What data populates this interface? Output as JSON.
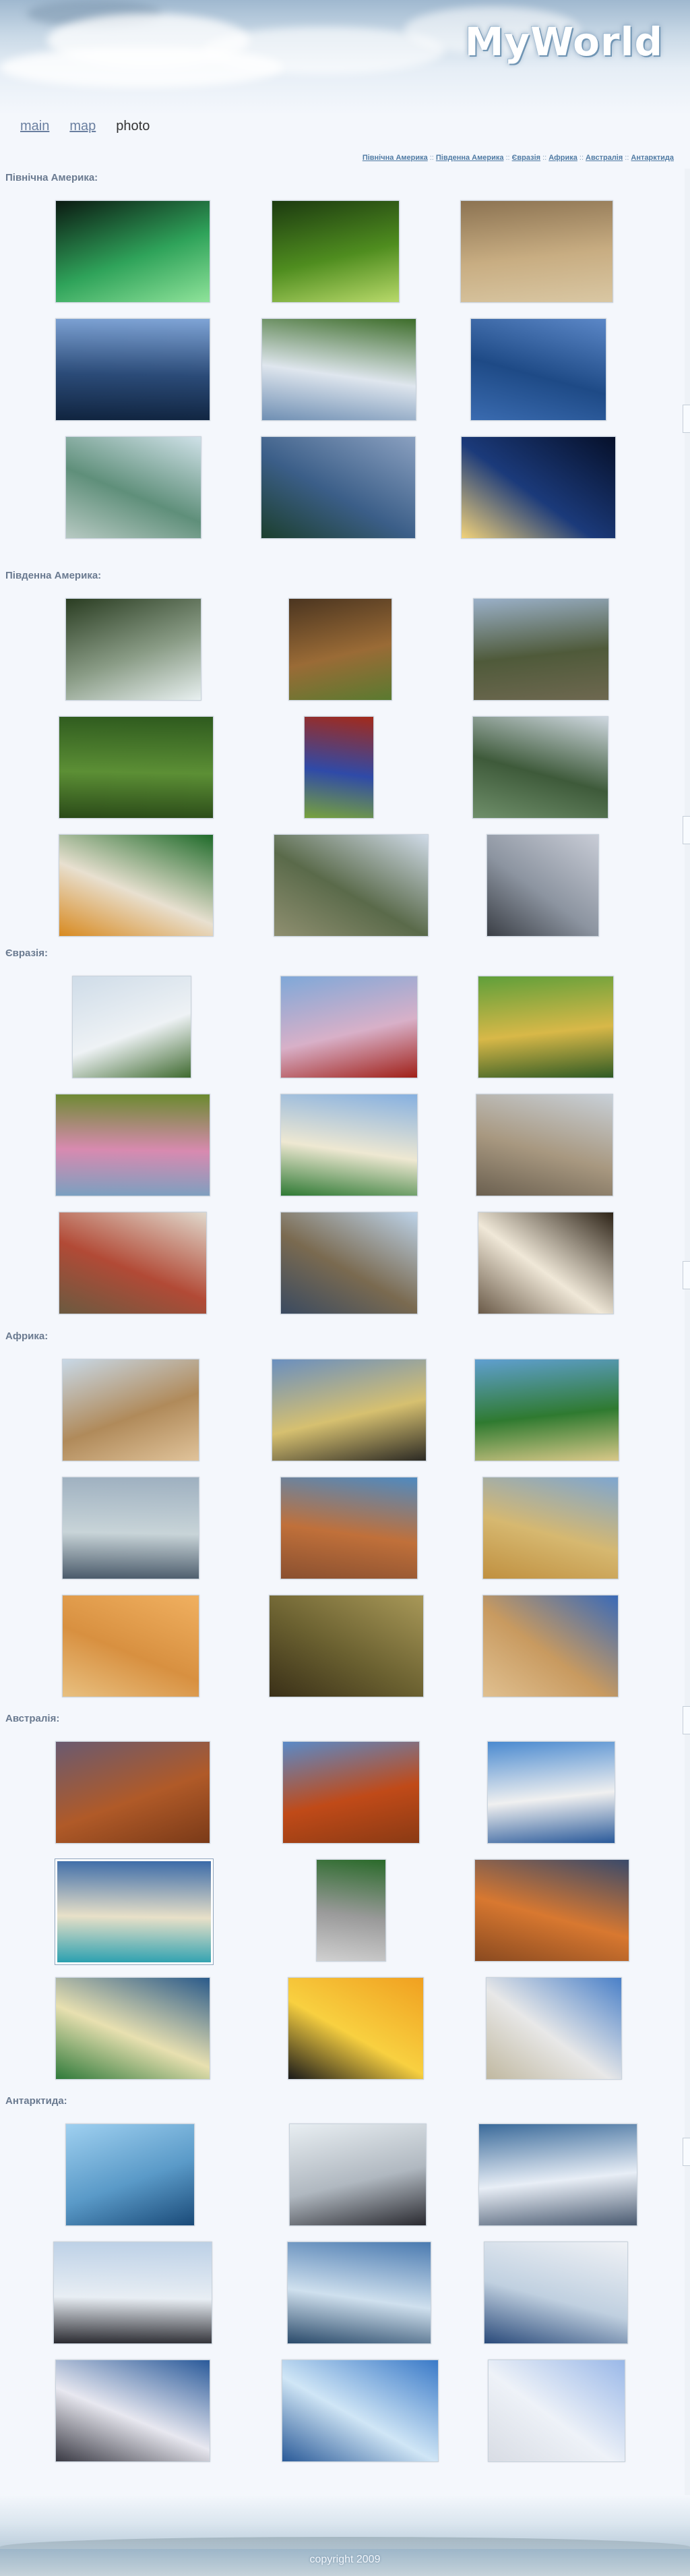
{
  "brand": "MyWorld",
  "nav": [
    {
      "label": "main",
      "link": true
    },
    {
      "label": "map",
      "link": true
    },
    {
      "label": "photo",
      "link": false
    }
  ],
  "breadcrumbs": [
    "Північна Америка",
    "Південна Америка",
    "Євразія",
    "Африка",
    "Австралія",
    "Антарктида"
  ],
  "breadcrumb_separator": "::",
  "sections": [
    {
      "title": "Північна Америка:",
      "photos": [
        "aurora over lake",
        "green forest path",
        "rock carvings",
        "city skyline with tower",
        "capitol with reflecting pool",
        "blue lake in mountains",
        "river with bridge",
        "mountain lake",
        "city lights at night"
      ]
    },
    {
      "title": "Південна Америка:",
      "photos": [
        "waterfalls",
        "sloth in tree",
        "mountain ruins",
        "terraced tea fields",
        "blue poison frog",
        "crater lake",
        "toucan",
        "machu picchu",
        "christ statue"
      ]
    },
    {
      "title": "Євразія:",
      "photos": [
        "japanese castle",
        "pagoda with cherry blossom",
        "golden pavilion",
        "river with blossoms",
        "golden domed monastery",
        "tower fortress",
        "red square",
        "westminster palace",
        "eiffel tower"
      ]
    },
    {
      "title": "Африка:",
      "photos": [
        "shoes hanging on branch",
        "elephants on savanna",
        "coastline with palms",
        "flamingos on lake",
        "giraffes",
        "pyramids",
        "sand dunes",
        "cheetahs in grass",
        "clay dwellings"
      ]
    },
    {
      "title": "Австралія:",
      "photos": [
        "red outback hills",
        "uluru rock",
        "sydney opera house",
        "white beach cove",
        "koala",
        "gorge at sunset",
        "bay with beach",
        "kangaroo at sunset",
        "coastal skyline"
      ]
    },
    {
      "title": "Антарктида:",
      "photos": [
        "iceberg with seals",
        "penguins on rocks",
        "snowy peaks",
        "penguin colony",
        "glacier with boat",
        "ice formations",
        "ice column",
        "iceberg wall",
        "polar bear"
      ]
    }
  ],
  "colors": {
    "accent": "#4f7aa3",
    "section_title": "#6a7a90",
    "background": "#f4f7fc"
  },
  "copyright": "copyright 2009"
}
